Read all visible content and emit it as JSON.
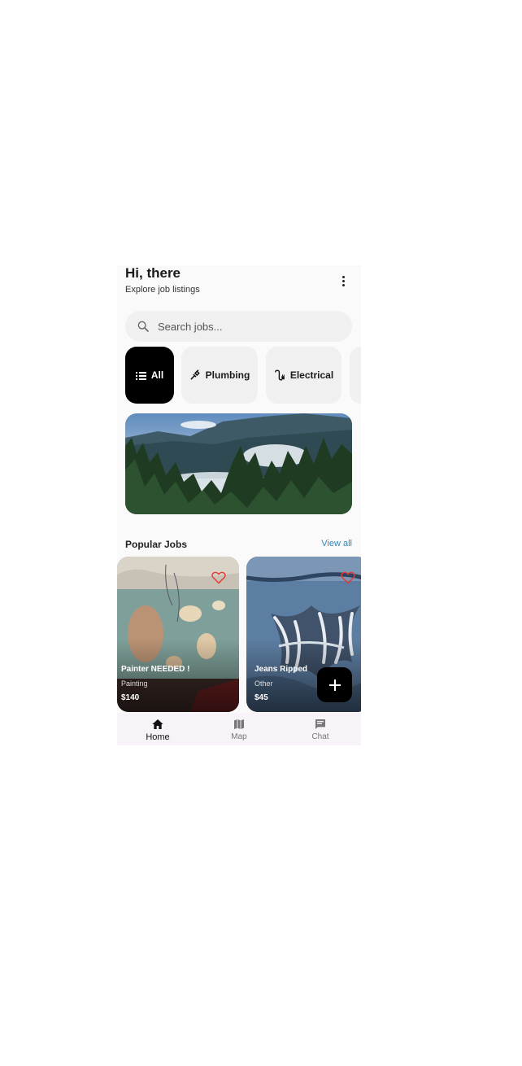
{
  "header": {
    "greeting": "Hi, there",
    "subtitle": "Explore job listings"
  },
  "search": {
    "placeholder": "Search jobs..."
  },
  "categories": [
    {
      "label": "All",
      "icon": "list-icon",
      "active": true
    },
    {
      "label": "Plumbing",
      "icon": "plumbing-icon",
      "active": false
    },
    {
      "label": "Electrical",
      "icon": "electrical-icon",
      "active": false
    }
  ],
  "section": {
    "title": "Popular Jobs",
    "view_all": "View all"
  },
  "jobs": [
    {
      "title": "Painter NEEDED !",
      "category": "Painting",
      "price": "$140",
      "favorite_icon": "heart-outline-icon"
    },
    {
      "title": "Jeans Ripped",
      "category": "Other",
      "price": "$45",
      "favorite_icon": "heart-outline-icon"
    }
  ],
  "nav": [
    {
      "label": "Home",
      "icon": "home-icon",
      "active": true
    },
    {
      "label": "Map",
      "icon": "map-icon",
      "active": false
    },
    {
      "label": "Chat",
      "icon": "chat-icon",
      "active": false
    }
  ],
  "colors": {
    "accent": "#000000",
    "link": "#2e86c1",
    "favorite": "#e53935"
  }
}
